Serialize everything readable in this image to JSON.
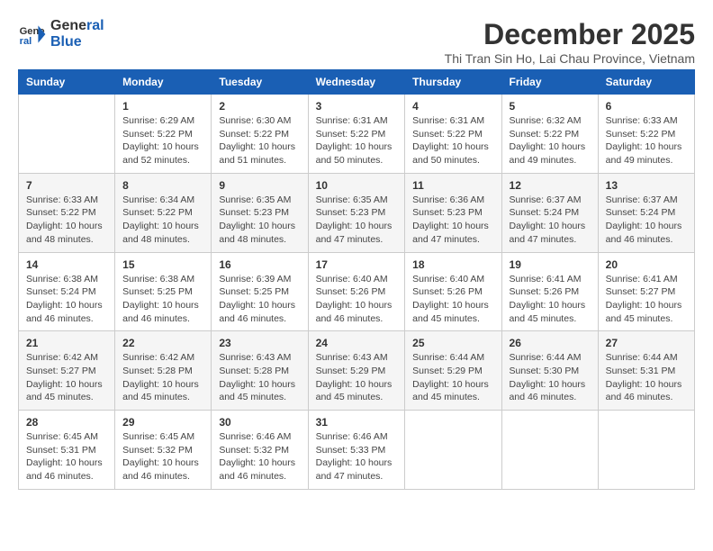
{
  "logo": {
    "line1": "General",
    "line2": "Blue"
  },
  "title": "December 2025",
  "location": "Thi Tran Sin Ho, Lai Chau Province, Vietnam",
  "weekdays": [
    "Sunday",
    "Monday",
    "Tuesday",
    "Wednesday",
    "Thursday",
    "Friday",
    "Saturday"
  ],
  "weeks": [
    [
      {
        "day": "",
        "info": ""
      },
      {
        "day": "1",
        "info": "Sunrise: 6:29 AM\nSunset: 5:22 PM\nDaylight: 10 hours\nand 52 minutes."
      },
      {
        "day": "2",
        "info": "Sunrise: 6:30 AM\nSunset: 5:22 PM\nDaylight: 10 hours\nand 51 minutes."
      },
      {
        "day": "3",
        "info": "Sunrise: 6:31 AM\nSunset: 5:22 PM\nDaylight: 10 hours\nand 50 minutes."
      },
      {
        "day": "4",
        "info": "Sunrise: 6:31 AM\nSunset: 5:22 PM\nDaylight: 10 hours\nand 50 minutes."
      },
      {
        "day": "5",
        "info": "Sunrise: 6:32 AM\nSunset: 5:22 PM\nDaylight: 10 hours\nand 49 minutes."
      },
      {
        "day": "6",
        "info": "Sunrise: 6:33 AM\nSunset: 5:22 PM\nDaylight: 10 hours\nand 49 minutes."
      }
    ],
    [
      {
        "day": "7",
        "info": "Sunrise: 6:33 AM\nSunset: 5:22 PM\nDaylight: 10 hours\nand 48 minutes."
      },
      {
        "day": "8",
        "info": "Sunrise: 6:34 AM\nSunset: 5:22 PM\nDaylight: 10 hours\nand 48 minutes."
      },
      {
        "day": "9",
        "info": "Sunrise: 6:35 AM\nSunset: 5:23 PM\nDaylight: 10 hours\nand 48 minutes."
      },
      {
        "day": "10",
        "info": "Sunrise: 6:35 AM\nSunset: 5:23 PM\nDaylight: 10 hours\nand 47 minutes."
      },
      {
        "day": "11",
        "info": "Sunrise: 6:36 AM\nSunset: 5:23 PM\nDaylight: 10 hours\nand 47 minutes."
      },
      {
        "day": "12",
        "info": "Sunrise: 6:37 AM\nSunset: 5:24 PM\nDaylight: 10 hours\nand 47 minutes."
      },
      {
        "day": "13",
        "info": "Sunrise: 6:37 AM\nSunset: 5:24 PM\nDaylight: 10 hours\nand 46 minutes."
      }
    ],
    [
      {
        "day": "14",
        "info": "Sunrise: 6:38 AM\nSunset: 5:24 PM\nDaylight: 10 hours\nand 46 minutes."
      },
      {
        "day": "15",
        "info": "Sunrise: 6:38 AM\nSunset: 5:25 PM\nDaylight: 10 hours\nand 46 minutes."
      },
      {
        "day": "16",
        "info": "Sunrise: 6:39 AM\nSunset: 5:25 PM\nDaylight: 10 hours\nand 46 minutes."
      },
      {
        "day": "17",
        "info": "Sunrise: 6:40 AM\nSunset: 5:26 PM\nDaylight: 10 hours\nand 46 minutes."
      },
      {
        "day": "18",
        "info": "Sunrise: 6:40 AM\nSunset: 5:26 PM\nDaylight: 10 hours\nand 45 minutes."
      },
      {
        "day": "19",
        "info": "Sunrise: 6:41 AM\nSunset: 5:26 PM\nDaylight: 10 hours\nand 45 minutes."
      },
      {
        "day": "20",
        "info": "Sunrise: 6:41 AM\nSunset: 5:27 PM\nDaylight: 10 hours\nand 45 minutes."
      }
    ],
    [
      {
        "day": "21",
        "info": "Sunrise: 6:42 AM\nSunset: 5:27 PM\nDaylight: 10 hours\nand 45 minutes."
      },
      {
        "day": "22",
        "info": "Sunrise: 6:42 AM\nSunset: 5:28 PM\nDaylight: 10 hours\nand 45 minutes."
      },
      {
        "day": "23",
        "info": "Sunrise: 6:43 AM\nSunset: 5:28 PM\nDaylight: 10 hours\nand 45 minutes."
      },
      {
        "day": "24",
        "info": "Sunrise: 6:43 AM\nSunset: 5:29 PM\nDaylight: 10 hours\nand 45 minutes."
      },
      {
        "day": "25",
        "info": "Sunrise: 6:44 AM\nSunset: 5:29 PM\nDaylight: 10 hours\nand 45 minutes."
      },
      {
        "day": "26",
        "info": "Sunrise: 6:44 AM\nSunset: 5:30 PM\nDaylight: 10 hours\nand 46 minutes."
      },
      {
        "day": "27",
        "info": "Sunrise: 6:44 AM\nSunset: 5:31 PM\nDaylight: 10 hours\nand 46 minutes."
      }
    ],
    [
      {
        "day": "28",
        "info": "Sunrise: 6:45 AM\nSunset: 5:31 PM\nDaylight: 10 hours\nand 46 minutes."
      },
      {
        "day": "29",
        "info": "Sunrise: 6:45 AM\nSunset: 5:32 PM\nDaylight: 10 hours\nand 46 minutes."
      },
      {
        "day": "30",
        "info": "Sunrise: 6:46 AM\nSunset: 5:32 PM\nDaylight: 10 hours\nand 46 minutes."
      },
      {
        "day": "31",
        "info": "Sunrise: 6:46 AM\nSunset: 5:33 PM\nDaylight: 10 hours\nand 47 minutes."
      },
      {
        "day": "",
        "info": ""
      },
      {
        "day": "",
        "info": ""
      },
      {
        "day": "",
        "info": ""
      }
    ]
  ]
}
